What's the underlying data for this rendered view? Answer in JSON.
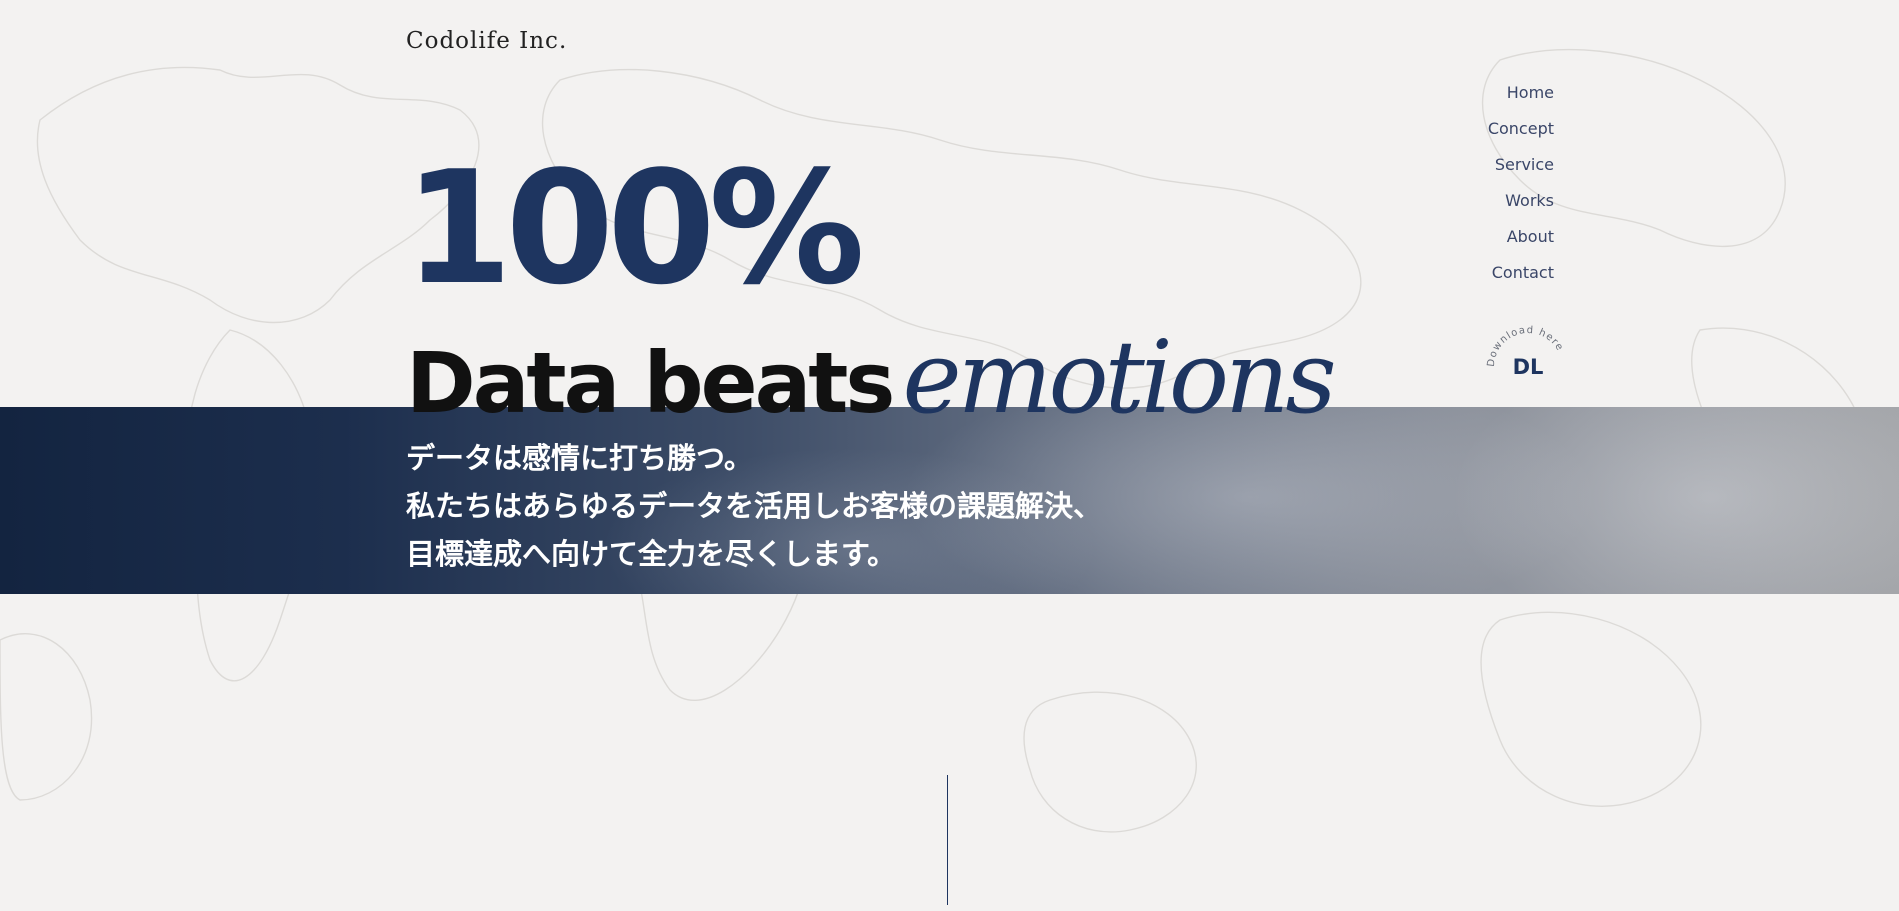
{
  "brand": {
    "logo_text": "Codolife Inc."
  },
  "hero": {
    "number": "100%",
    "tagline_bold": "Data beats",
    "tagline_script": "emotions",
    "copy_lines": [
      "データは感情に打ち勝つ。",
      "私たちはあらゆるデータを活用しお客様の課題解決、",
      "目標達成へ向けて全力を尽くします。"
    ]
  },
  "nav": {
    "items": [
      {
        "label": "Home"
      },
      {
        "label": "Concept"
      },
      {
        "label": "Service"
      },
      {
        "label": "Works"
      },
      {
        "label": "About"
      },
      {
        "label": "Contact"
      }
    ]
  },
  "download": {
    "label": "DL",
    "ring_text": "Download here"
  },
  "colors": {
    "navy": "#1e3560",
    "background": "#f3f2f1",
    "band_dark": "#132440"
  }
}
